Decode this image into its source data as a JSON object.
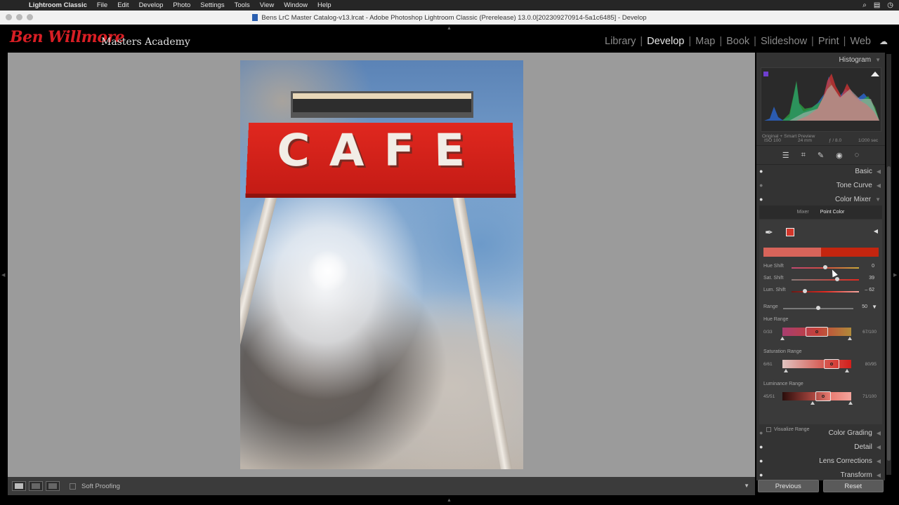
{
  "menubar": {
    "app": "Lightroom Classic",
    "items": [
      "File",
      "Edit",
      "Develop",
      "Photo",
      "Settings",
      "Tools",
      "View",
      "Window",
      "Help"
    ]
  },
  "window": {
    "title": "Bens LrC Master Catalog-v13.lrcat - Adobe Photoshop Lightroom Classic (Prerelease) 13.0.0[202309270914-5a1c6485] - Develop"
  },
  "identity": {
    "script": "Ben Willmore",
    "name": "Masters Academy"
  },
  "modules": [
    "Library",
    "Develop",
    "Map",
    "Book",
    "Slideshow",
    "Print",
    "Web"
  ],
  "active_module": "Develop",
  "photo": {
    "sign_text": "CAFE"
  },
  "toolbar": {
    "soft_proofing": "Soft Proofing"
  },
  "histogram": {
    "title": "Histogram",
    "iso": "ISO 100",
    "focal": "24 mm",
    "aperture": "ƒ / 8.0",
    "shutter": "1/200 sec",
    "preview": "Original + Smart Preview"
  },
  "panels": {
    "basic": "Basic",
    "tone_curve": "Tone Curve",
    "color_mixer": "Color Mixer",
    "color_grading": "Color Grading",
    "detail": "Detail",
    "lens_corrections": "Lens Corrections",
    "transform": "Transform"
  },
  "color_mixer": {
    "tabs": [
      "Mixer",
      "Point Color"
    ],
    "active_tab": "Point Color",
    "sliders": [
      {
        "label": "Hue Shift",
        "value": "0",
        "pos": 0.5,
        "track": "hue"
      },
      {
        "label": "Sat. Shift",
        "value": "39",
        "pos": 0.68,
        "track": "sat"
      },
      {
        "label": "Lum. Shift",
        "value": "– 62",
        "pos": 0.2,
        "track": "lum"
      }
    ],
    "range": {
      "label": "Range",
      "value": "50",
      "pos": 0.5
    },
    "hue_range": {
      "label": "Hue Range",
      "min": "0/33",
      "max": "67/100"
    },
    "saturation_range": {
      "label": "Saturation Range",
      "min": "6/61",
      "max": "80/95"
    },
    "luminance_range": {
      "label": "Luminance Range",
      "min": "45/51",
      "max": "71/100"
    },
    "visualize": "Visualize Range"
  },
  "footer": {
    "previous": "Previous",
    "reset": "Reset"
  },
  "colors": {
    "accent_red": "#d81e24",
    "swatch": "#d2362a"
  }
}
